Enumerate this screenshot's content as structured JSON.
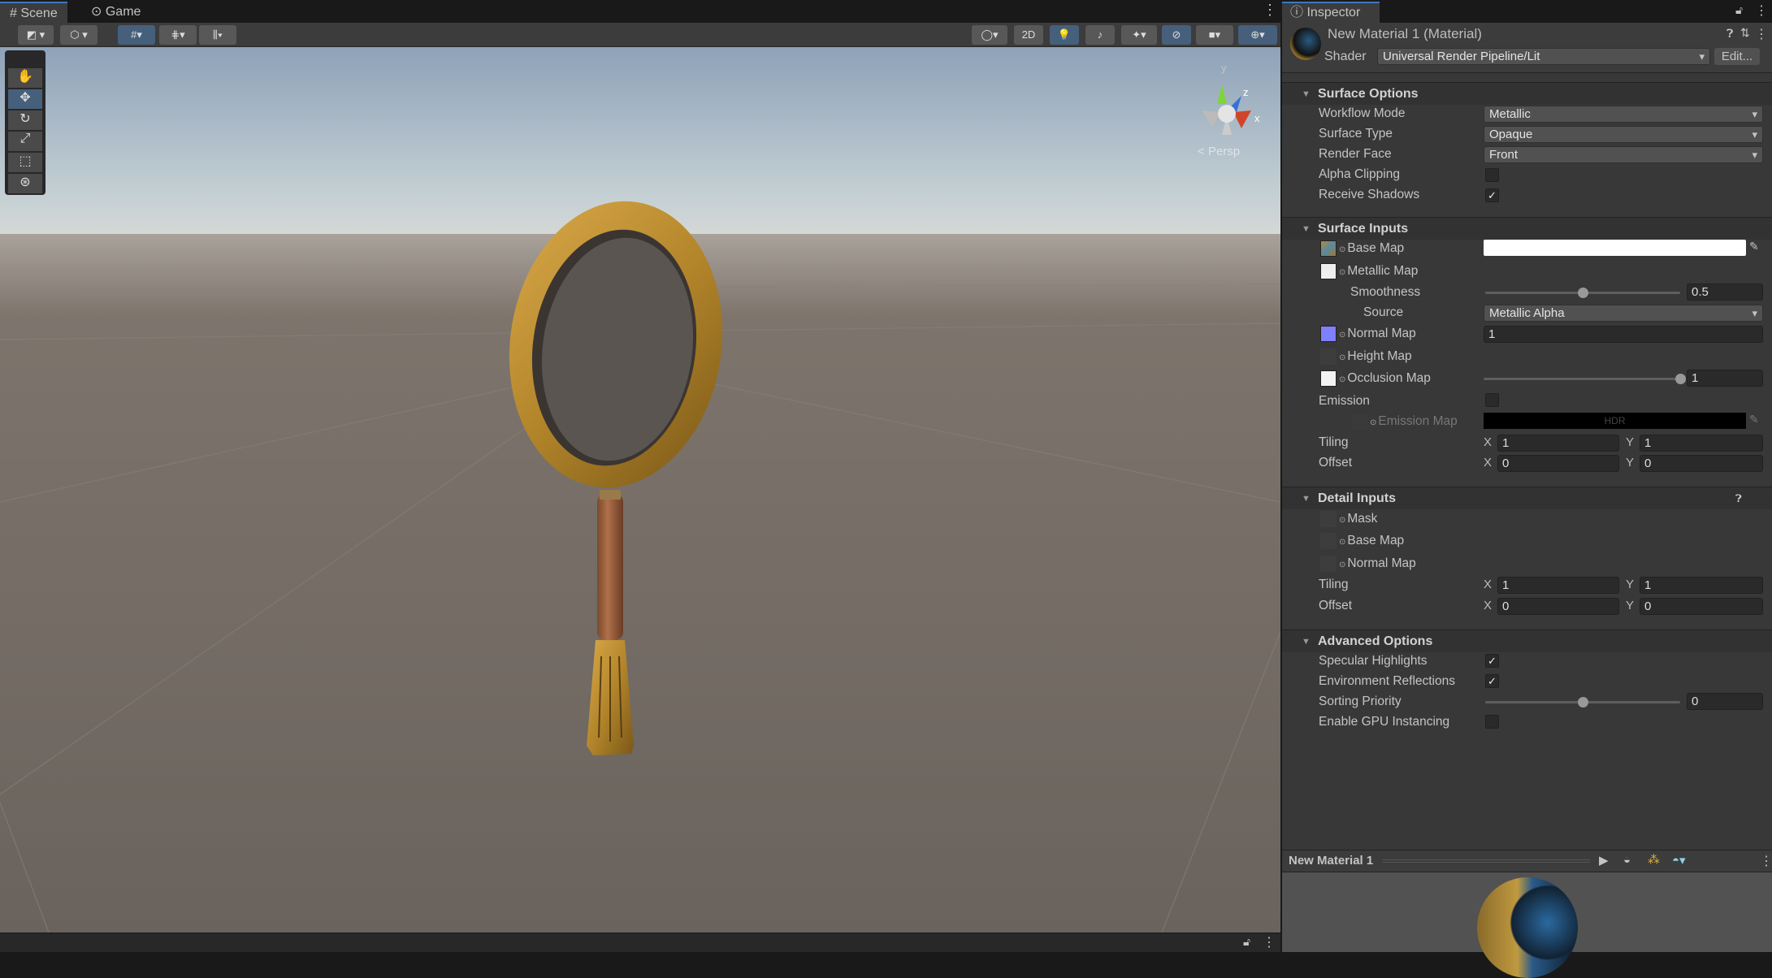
{
  "tabs": {
    "scene": "Scene",
    "game": "Game"
  },
  "toolbar": {
    "mode_2d": "2D"
  },
  "scene": {
    "persp_label": "Persp",
    "gizmo": {
      "y": "y",
      "z": "z",
      "x": "x"
    }
  },
  "inspector": {
    "tab": "Inspector",
    "material_title": "New Material 1 (Material)",
    "shader_label": "Shader",
    "shader_value": "Universal Render Pipeline/Lit",
    "edit_button": "Edit...",
    "surface_options": {
      "title": "Surface Options",
      "workflow_mode": {
        "label": "Workflow Mode",
        "value": "Metallic"
      },
      "surface_type": {
        "label": "Surface Type",
        "value": "Opaque"
      },
      "render_face": {
        "label": "Render Face",
        "value": "Front"
      },
      "alpha_clipping": {
        "label": "Alpha Clipping",
        "checked": false
      },
      "receive_shadows": {
        "label": "Receive Shadows",
        "checked": true
      }
    },
    "surface_inputs": {
      "title": "Surface Inputs",
      "base_map": "Base Map",
      "metallic_map": "Metallic Map",
      "smoothness": {
        "label": "Smoothness",
        "value": "0.5",
        "fraction": 0.5
      },
      "source": {
        "label": "Source",
        "value": "Metallic Alpha"
      },
      "normal_map": {
        "label": "Normal Map",
        "value": "1"
      },
      "height_map": "Height Map",
      "occlusion_map": {
        "label": "Occlusion Map",
        "value": "1",
        "fraction": 1
      },
      "emission": "Emission",
      "emission_map": "Emission Map",
      "hdr": "HDR",
      "tiling": {
        "label": "Tiling",
        "x": "1",
        "y": "1"
      },
      "offset": {
        "label": "Offset",
        "x": "0",
        "y": "0"
      }
    },
    "detail_inputs": {
      "title": "Detail Inputs",
      "mask": "Mask",
      "base_map": "Base Map",
      "normal_map": "Normal Map",
      "tiling": {
        "label": "Tiling",
        "x": "1",
        "y": "1"
      },
      "offset": {
        "label": "Offset",
        "x": "0",
        "y": "0"
      }
    },
    "advanced_options": {
      "title": "Advanced Options",
      "specular_highlights": {
        "label": "Specular Highlights",
        "checked": true
      },
      "environment_reflections": {
        "label": "Environment Reflections",
        "checked": true
      },
      "sorting_priority": {
        "label": "Sorting Priority",
        "value": "0",
        "fraction": 0.5
      },
      "gpu_instancing": {
        "label": "Enable GPU Instancing",
        "checked": false
      }
    },
    "axis": {
      "x": "X",
      "y": "Y"
    },
    "check": "✓",
    "preview": {
      "title": "New Material 1"
    }
  }
}
